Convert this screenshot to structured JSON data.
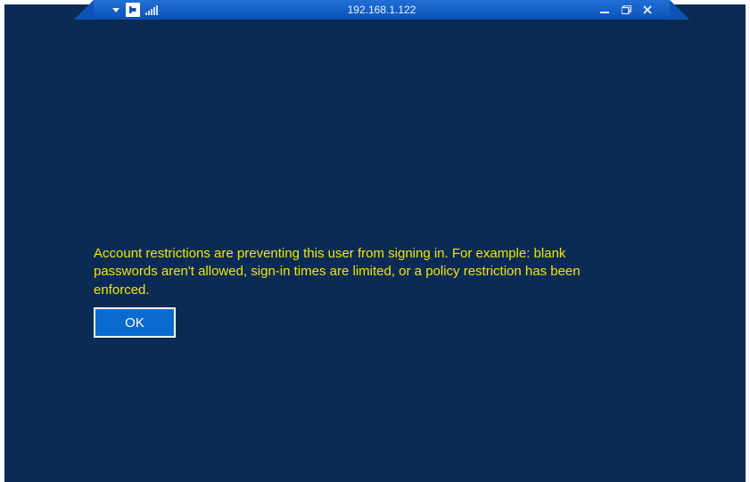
{
  "window": {
    "title": "192.168.1.122"
  },
  "icons": {
    "dropdown": "dropdown",
    "pin": "pin",
    "signal": "signal",
    "minimize": "minimize",
    "restore": "restore",
    "close": "close"
  },
  "error": {
    "message": "Account restrictions are preventing this user from signing in. For example: blank passwords aren't allowed, sign-in times are limited, or a policy restriction has been enforced."
  },
  "buttons": {
    "ok": "OK"
  }
}
